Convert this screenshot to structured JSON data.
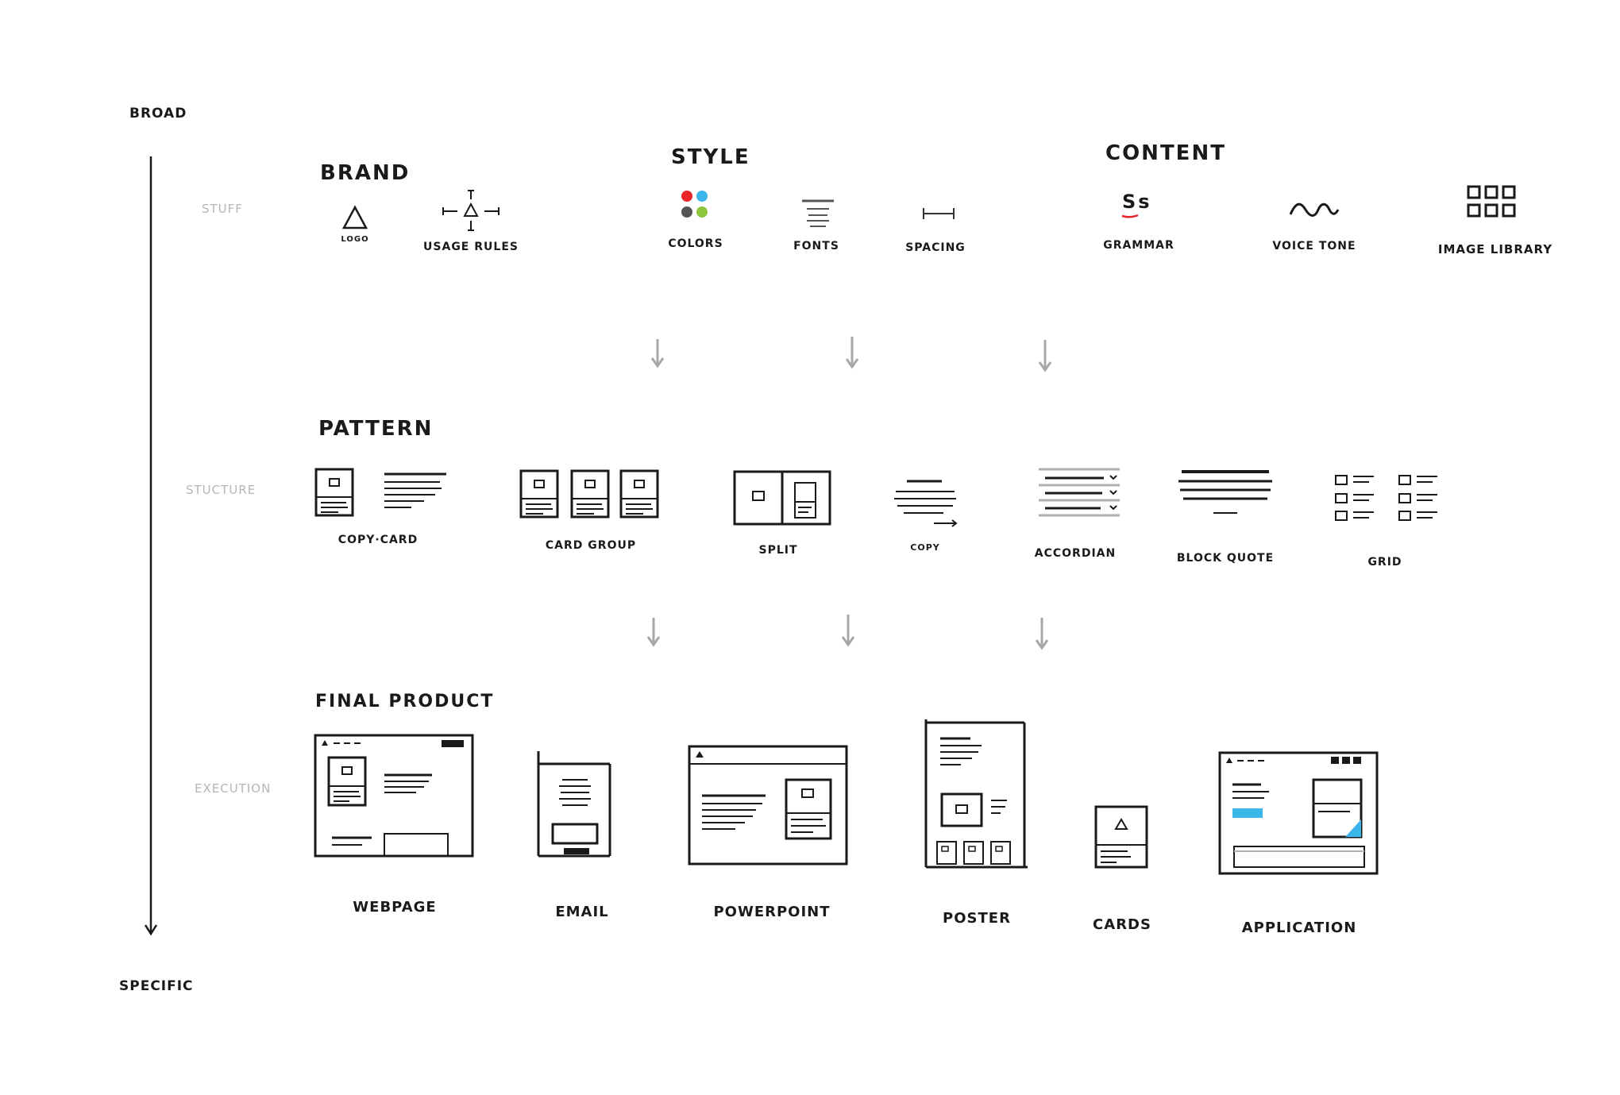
{
  "axis": {
    "top": "BROAD",
    "bottom": "SPECIFIC"
  },
  "rows": [
    {
      "label": "STUFF"
    },
    {
      "label": "STUCTURE"
    },
    {
      "label": "EXECUTION"
    }
  ],
  "sections": {
    "brand": "BRAND",
    "style": "STYLE",
    "content": "CONTENT",
    "pattern": "PATTERN",
    "final_product": "FINAL PRODUCT"
  },
  "stuff_items": {
    "logo": "LOGO",
    "usage_rules": "USAGE RULES",
    "colors": "COLORS",
    "fonts": "FONTS",
    "spacing": "SPACING",
    "grammar": "GRAMMAR",
    "voice_tone": "VOICE TONE",
    "image_library": "IMAGE LIBRARY"
  },
  "grammar_glyph": "Ss",
  "pattern_items": {
    "copy_card": "COPY·CARD",
    "card_group": "CARD GROUP",
    "split": "SPLIT",
    "copy": "COPY",
    "accordian": "ACCORDIAN",
    "block_quote": "BLOCK QUOTE",
    "grid": "GRID"
  },
  "product_items": {
    "webpage": "WEBPAGE",
    "email": "EMAIL",
    "powerpoint": "POWERPOINT",
    "poster": "POSTER",
    "cards": "CARDS",
    "application": "APPLICATION"
  },
  "colors": {
    "ink": "#1a1a1a",
    "faint": "#b5b5b5",
    "arrow": "#a8a8a8",
    "swatch_red": "#e8232a",
    "swatch_blue": "#3cb5ea",
    "swatch_dark": "#555555",
    "swatch_green": "#8cc63f",
    "grammar_underline": "#e8232a",
    "app_accent": "#3cb5ea"
  }
}
